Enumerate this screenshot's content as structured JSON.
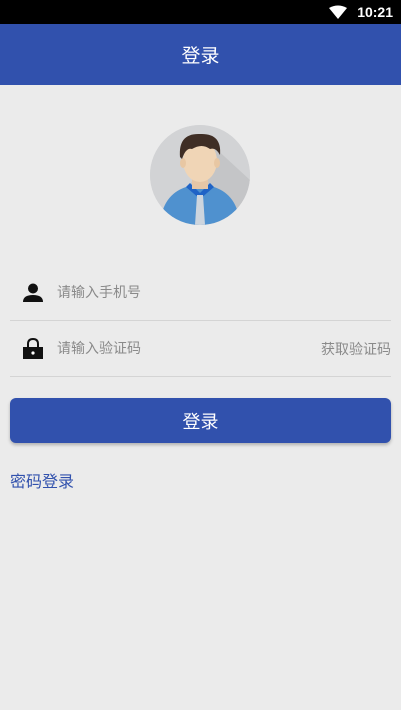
{
  "status_bar": {
    "time": "10:21",
    "wifi_icon": "wifi-icon"
  },
  "app_bar": {
    "title": "登录"
  },
  "avatar": {
    "icon": "user-avatar-illustration"
  },
  "form": {
    "phone": {
      "placeholder": "请输入手机号",
      "value": "",
      "icon": "person-icon"
    },
    "code": {
      "placeholder": "请输入验证码",
      "value": "",
      "icon": "lock-icon",
      "get_code_label": "获取验证码"
    }
  },
  "actions": {
    "login_label": "登录",
    "password_login_label": "密码登录"
  },
  "colors": {
    "primary": "#3151ad",
    "background": "#ebebeb",
    "status_bar": "#000000",
    "hint": "#8a8a8a"
  }
}
